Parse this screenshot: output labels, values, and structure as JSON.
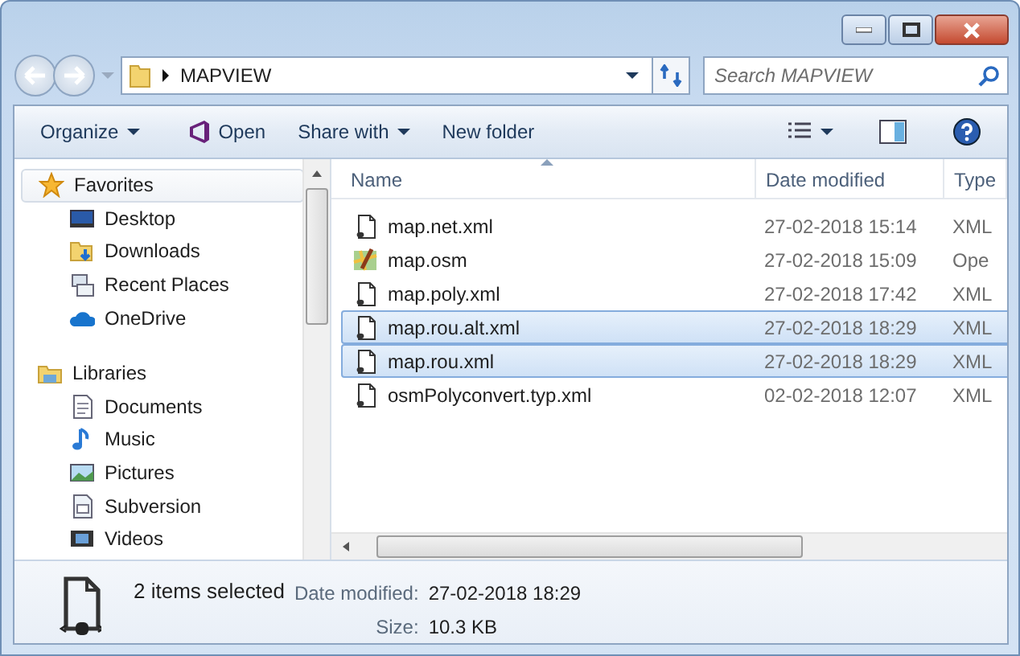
{
  "address": {
    "path": "MAPVIEW"
  },
  "search": {
    "placeholder": "Search MAPVIEW"
  },
  "toolbar": [
    {
      "label": "Organize",
      "kind": "menu"
    },
    {
      "label": "Open",
      "kind": "open"
    },
    {
      "label": "Share with",
      "kind": "menu"
    },
    {
      "label": "New folder",
      "kind": "plain"
    }
  ],
  "nav": [
    {
      "label": "Favorites",
      "kind": "star",
      "children": [
        {
          "label": "Desktop",
          "kind": "desktop"
        },
        {
          "label": "Downloads",
          "kind": "downloads"
        },
        {
          "label": "Recent Places",
          "kind": "recent"
        },
        {
          "label": "OneDrive",
          "kind": "cloud"
        }
      ]
    },
    {
      "label": "Libraries",
      "kind": "library",
      "children": [
        {
          "label": "Documents",
          "kind": "documents"
        },
        {
          "label": "Music",
          "kind": "music"
        },
        {
          "label": "Pictures",
          "kind": "pictures"
        },
        {
          "label": "Subversion",
          "kind": "subversion"
        },
        {
          "label": "Videos",
          "kind": "videos"
        }
      ]
    }
  ],
  "columns": [
    {
      "label": "Name",
      "sorted": true
    },
    {
      "label": "Date modified",
      "sorted": false
    },
    {
      "label": "Type",
      "sorted": false
    }
  ],
  "files": [
    {
      "name": "map.net.xml",
      "date": "27-02-2018 15:14",
      "type": "XML",
      "kind": "xml",
      "selected": false
    },
    {
      "name": "map.osm",
      "date": "27-02-2018 15:09",
      "type": "Ope",
      "kind": "osm",
      "selected": false
    },
    {
      "name": "map.poly.xml",
      "date": "27-02-2018 17:42",
      "type": "XML",
      "kind": "xml",
      "selected": false
    },
    {
      "name": "map.rou.alt.xml",
      "date": "27-02-2018 18:29",
      "type": "XML",
      "kind": "xml",
      "selected": true
    },
    {
      "name": "map.rou.xml",
      "date": "27-02-2018 18:29",
      "type": "XML",
      "kind": "xml",
      "selected": true
    },
    {
      "name": "osmPolyconvert.typ.xml",
      "date": "02-02-2018 12:07",
      "type": "XML",
      "kind": "xml",
      "selected": false
    }
  ],
  "details": {
    "summary": "2 items selected",
    "fields": [
      {
        "label": "Date modified:",
        "value": "27-02-2018 18:29"
      },
      {
        "label": "Size:",
        "value": "10.3 KB"
      }
    ]
  }
}
